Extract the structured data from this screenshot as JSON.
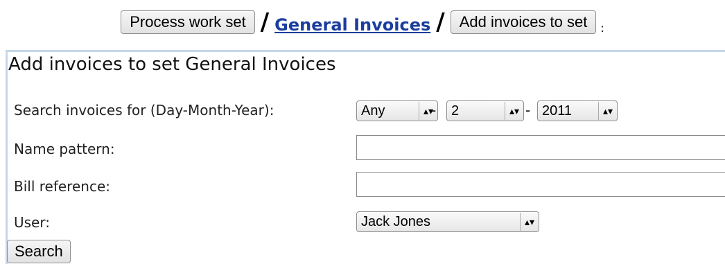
{
  "breadcrumb": {
    "process_button": "Process work set",
    "separator": "/",
    "set_link": "General Invoices",
    "add_button": "Add invoices to set",
    "colon": ":"
  },
  "form": {
    "title": "Add invoices to set General Invoices",
    "date_label": "Search invoices for (Day-Month-Year):",
    "day_value": "Any",
    "month_value": "2",
    "year_value": "2011",
    "dash": "-",
    "name_label": "Name pattern:",
    "name_value": "",
    "bill_label": "Bill reference:",
    "bill_value": "",
    "user_label": "User:",
    "user_value": "Jack Jones",
    "search_button": "Search"
  }
}
